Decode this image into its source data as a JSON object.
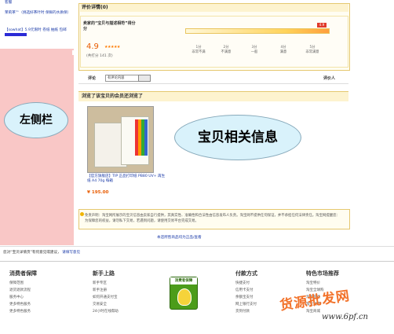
{
  "sidebar": {
    "top_link": "客服",
    "link1": "茉莉茶™（挑选好茶叶时 保鲜的水质保）",
    "link2": "【sowhat】5.9元限时 卷纸 抽纸 包邮",
    "bubble": "左侧栏"
  },
  "reviews": {
    "title": "评价详情(0)",
    "question": "卖家的“宝贝与描述相符”得分",
    "score": "4.9",
    "unit": "分",
    "stars": "★★★★★",
    "count": "(共打分 141 次)",
    "marker": "4.9",
    "ticks": [
      {
        "score": "1分",
        "label": "非常不满"
      },
      {
        "score": "2分",
        "label": "不满意"
      },
      {
        "score": "3分",
        "label": "一般"
      },
      {
        "score": "4分",
        "label": "满意"
      },
      {
        "score": "5分",
        "label": "非常满意"
      }
    ]
  },
  "filter": {
    "label": "评论",
    "select_value": "有评论内容",
    "reviewer_header": "评价人"
  },
  "viewed_also": {
    "title": "浏览了该宝贝的会员还浏览了",
    "bubble": "宝贝相关信息",
    "product_name": "【官方旗舰店】TIP 正品打印纸 PB80 UV+ 再生纸 A4 70g 每箱",
    "price": "¥ 195.00"
  },
  "disclaimer": {
    "text": "免责声明：淘宝网所展示的宝贝信息由卖家自行提供，其真实性、准确性和合法性由信息发布人负责。淘宝网不提供任何保证，并不承担任何法律责任。淘宝网提醒您：为保障您的权益，请勿私下交易，若遇到问题，请使用交易平台完成交易。"
  },
  "footer_link": "本店所售商品均为正品/查看",
  "feedback": {
    "text": "您对“宝贝详情页”有何意见或建议，",
    "link": "请填写意见"
  },
  "footer": {
    "columns": [
      {
        "title": "消费者保障",
        "items": [
          "保障范围",
          "退货退款流程",
          "服务中心",
          "更多特色服务",
          "更多特色服务"
        ]
      },
      {
        "title": "新手上路",
        "items": [
          "新手专区",
          "新手注册",
          "如何开通支付宝",
          "交易安全",
          "24小时在线帮助"
        ]
      },
      {
        "title": "付款方式",
        "items": [
          "快捷支付",
          "信用卡支付",
          "余额宝支付",
          "网上银行支付",
          "货到付款"
        ]
      },
      {
        "title": "特色市场推荐",
        "items": [
          "淘宝特价",
          "淘宝全球购",
          "淘宝游戏",
          "淘宝试用",
          "淘宝商城"
        ]
      }
    ],
    "badge_label": "消费者保障"
  },
  "watermark": {
    "text": "货源批发网",
    "url": "www.6pf.cn"
  }
}
